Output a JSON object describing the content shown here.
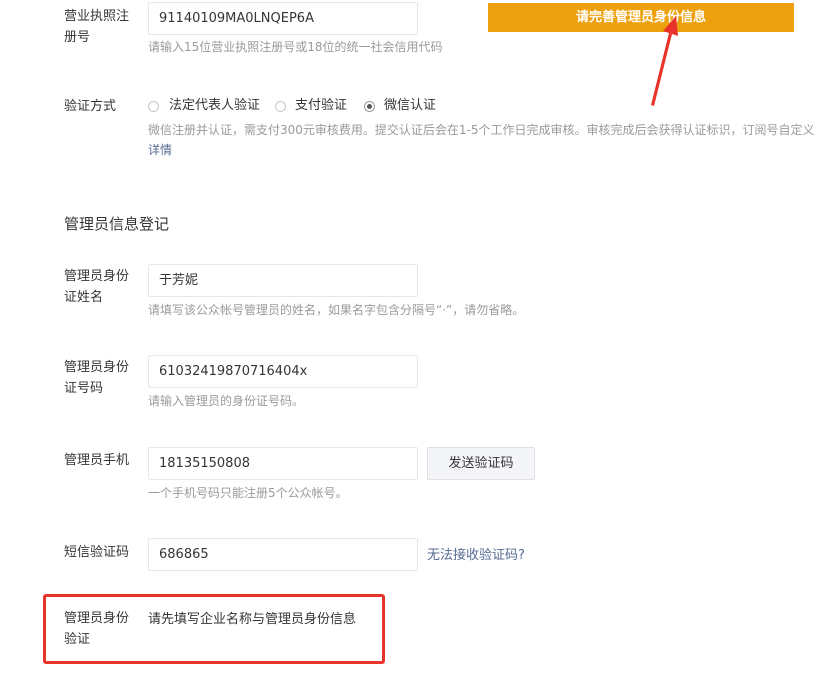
{
  "business_license": {
    "label_line1": "营业执照注",
    "label_line2": "册号",
    "value": "91140109MA0LNQEP6A",
    "hint": "请输入15位营业执照注册号或18位的统一社会信用代码"
  },
  "banner_button": {
    "label": "请完善管理员身份信息",
    "color": "#eea10f"
  },
  "verify_method": {
    "label": "验证方式",
    "options": [
      "法定代表人验证",
      "支付验证",
      "微信认证"
    ],
    "selected": "微信认证",
    "description": "微信注册并认证，需支付300元审核费用。提交认证后会在1-5个工作日完成审核。审核完成后会获得认证标识，订阅号自定义",
    "details_link": "详情"
  },
  "admin_section": {
    "title": "管理员信息登记"
  },
  "admin_name": {
    "label_line1": "管理员身份",
    "label_line2": "证姓名",
    "value": "于芳妮",
    "hint": "请填写该公众帐号管理员的姓名，如果名字包含分隔号“·”，请勿省略。"
  },
  "admin_id": {
    "label_line1": "管理员身份",
    "label_line2": "证号码",
    "value": "61032419870716404x",
    "hint": "请输入管理员的身份证号码。"
  },
  "admin_phone": {
    "label": "管理员手机",
    "value": "18135150808",
    "send_code_label": "发送验证码",
    "hint": "一个手机号码只能注册5个公众帐号。"
  },
  "sms_code": {
    "label": "短信验证码",
    "value": "686865",
    "help_link": "无法接收验证码?"
  },
  "admin_verify": {
    "label_line1": "管理员身份",
    "label_line2": "验证",
    "message": "请先填写企业名称与管理员身份信息"
  },
  "colors": {
    "annotation_red": "#e8332a",
    "link_blue": "#576b95"
  }
}
